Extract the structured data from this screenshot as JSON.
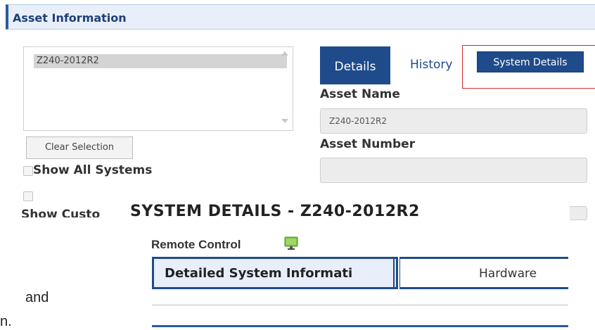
{
  "section_header": {
    "title": "Asset Information"
  },
  "system_list": {
    "selected_item": "Z240-2012R2"
  },
  "clear_button": {
    "label": "Clear Selection"
  },
  "checkboxes": {
    "show_all_systems": "Show All Systems",
    "show_custom_cut": "Show Custo"
  },
  "tabs": {
    "details": "Details",
    "history": "History",
    "system_details_button": "System Details"
  },
  "fields": {
    "asset_name_label": "Asset Name",
    "asset_name_value": "Z240-2012R2",
    "asset_number_label": "Asset Number",
    "asset_number_value": ""
  },
  "overlay": {
    "title": "SYSTEM DETAILS - Z240-2012R2",
    "remote_control_label": "Remote Control",
    "remote_icon": "monitor-icon",
    "tab_detailed": "Detailed System Informati",
    "tab_hardware": "Hardware"
  },
  "background_text": {
    "fragment_and": "and",
    "fragment_n": "n."
  },
  "colors": {
    "primary": "#1f4b8b",
    "header_bg": "#e8effa",
    "highlight": "#d42a2a"
  }
}
